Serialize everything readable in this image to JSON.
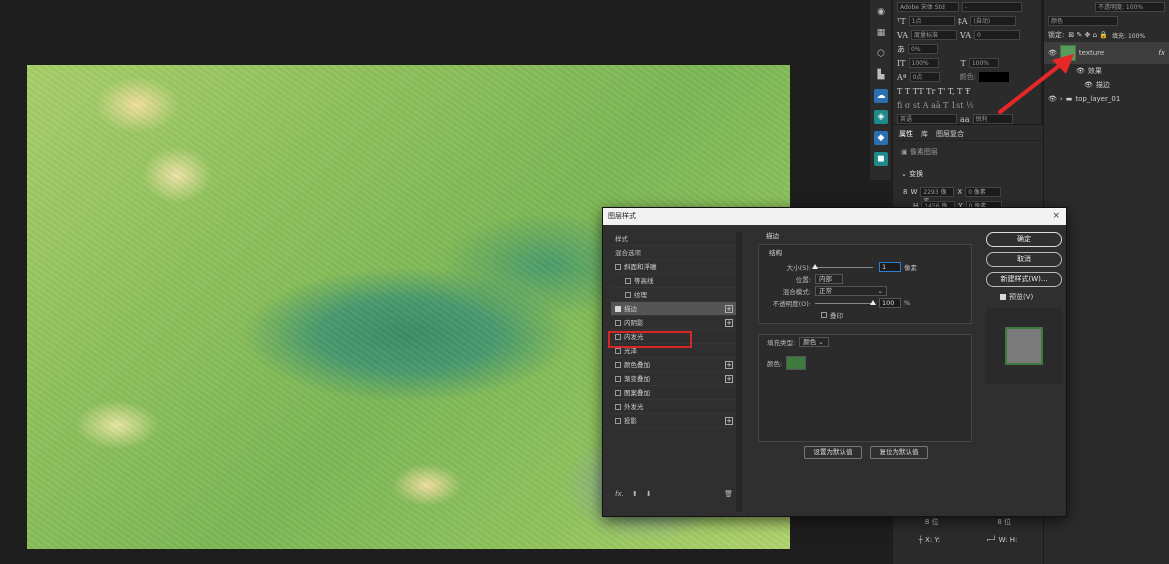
{
  "dialog": {
    "title": "图层样式",
    "close_glyph": "×",
    "left_list": [
      {
        "label": "样式",
        "type": "header"
      },
      {
        "label": "混合选项",
        "type": "header"
      },
      {
        "label": "斜面和浮雕",
        "type": "check",
        "checked": false
      },
      {
        "label": "等高线",
        "type": "check-indent",
        "checked": false
      },
      {
        "label": "纹理",
        "type": "check-indent",
        "checked": false
      },
      {
        "label": "描边",
        "type": "check",
        "checked": true,
        "plus": true,
        "selected": true
      },
      {
        "label": "内阴影",
        "type": "check",
        "checked": false,
        "plus": true
      },
      {
        "label": "内发光",
        "type": "check",
        "checked": false
      },
      {
        "label": "光泽",
        "type": "check",
        "checked": false
      },
      {
        "label": "颜色叠加",
        "type": "check",
        "checked": false,
        "plus": true
      },
      {
        "label": "渐变叠加",
        "type": "check",
        "checked": false,
        "plus": true
      },
      {
        "label": "图案叠加",
        "type": "check",
        "checked": false
      },
      {
        "label": "外发光",
        "type": "check",
        "checked": false
      },
      {
        "label": "投影",
        "type": "check",
        "checked": false,
        "plus": true
      }
    ],
    "footer": {
      "fx": "fx.",
      "up": "⬆",
      "down": "⬇",
      "trash": "🗑"
    },
    "stroke": {
      "section": "描边",
      "structure": "结构",
      "size_label": "大小(S):",
      "size_value": "1",
      "size_unit": "像素",
      "position_label": "位置:",
      "position_value": "内部",
      "blend_label": "混合模式:",
      "blend_value": "正常",
      "opacity_label": "不透明度(O):",
      "opacity_value": "100",
      "opacity_unit": "%",
      "overprint_label": "叠印",
      "fill_type_label": "填充类型:",
      "fill_type_value": "颜色",
      "color_label": "颜色:",
      "color_hex": "#3c7a3d",
      "set_default": "设置为默认值",
      "reset_default": "复位为默认值"
    },
    "buttons": {
      "ok": "确定",
      "cancel": "取消",
      "new_style": "新建样式(W)...",
      "preview": "预览(V)"
    }
  },
  "layers": {
    "top_row": "不透明度: 100%",
    "blend": "颜色",
    "lock_label": "锁定:",
    "fill_label": "填充: 100%",
    "items": [
      {
        "name": "texture",
        "fx": "fx"
      },
      {
        "name": "效果"
      },
      {
        "name": "描边"
      },
      {
        "name": "top_layer_01"
      }
    ]
  },
  "character": {
    "font": "Adobe 宋体 Std",
    "size": "1点",
    "leading": "(自动)",
    "kerning": "度量标准",
    "tracking": "0",
    "baseline": "0%",
    "v_scale": "100%",
    "h_scale": "100%",
    "shift": "0点",
    "color_label": "颜色:",
    "lang": "英语",
    "aa": "aa",
    "aa_value": "锐利",
    "glyph_row_1": "T  T  TT  Tr  T'  T,  T  Ŧ",
    "glyph_row_2": "fi  σ  st  A  aā  T  1st  ½"
  },
  "properties": {
    "tabs": [
      "属性",
      "库",
      "图层复合"
    ],
    "pixel_layer": "像素图层",
    "transform": "变换",
    "w_label": "W",
    "w_value": "2293 像素",
    "x_label": "X",
    "x_value": "0 像素",
    "h_label": "H",
    "h_value": "1456 像素",
    "y_label": "Y",
    "y_value": "0 像素",
    "bottom_1": "8 位",
    "bottom_2": "8 位",
    "x_short": "X:",
    "y_short": "Y:",
    "w_short": "W:",
    "h_short": "H:"
  }
}
